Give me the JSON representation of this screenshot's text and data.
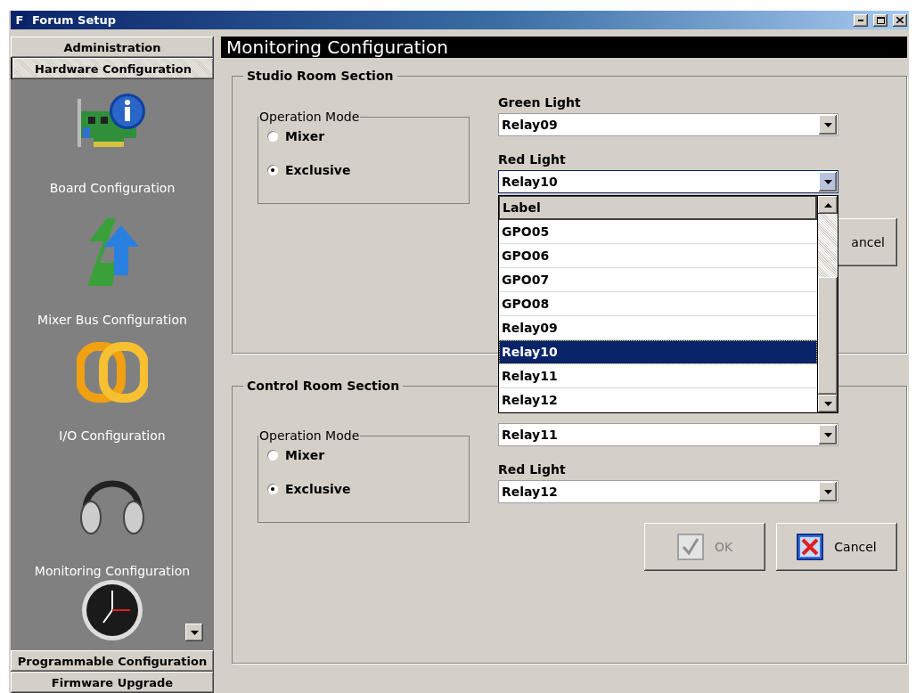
{
  "window": {
    "title": "Forum Setup",
    "icon_letter": "F"
  },
  "sidebar": {
    "tabs_top": [
      {
        "label": "Administration",
        "selected": false
      },
      {
        "label": "Hardware Configuration",
        "selected": true
      }
    ],
    "items": [
      {
        "label": "Board Configuration"
      },
      {
        "label": "Mixer Bus Configuration"
      },
      {
        "label": "I/O Configuration"
      },
      {
        "label": "Monitoring Configuration"
      }
    ],
    "tabs_bottom": [
      {
        "label": "Programmable Configuration",
        "selected": false
      },
      {
        "label": "Firmware Upgrade",
        "selected": false
      }
    ]
  },
  "main": {
    "title": "Monitoring Configuration",
    "sections": [
      {
        "title": "Studio Room Section",
        "operation_mode": {
          "label": "Operation Mode",
          "options": [
            {
              "label": "Mixer",
              "selected": false
            },
            {
              "label": "Exclusive",
              "selected": true
            }
          ]
        },
        "fields": [
          {
            "label": "Green Light",
            "value": "Relay09"
          },
          {
            "label": "Red Light",
            "value": "Relay10",
            "open_list": {
              "header": "Label",
              "options": [
                {
                  "label": "GPO05",
                  "selected": false
                },
                {
                  "label": "GPO06",
                  "selected": false
                },
                {
                  "label": "GPO07",
                  "selected": false
                },
                {
                  "label": "GPO08",
                  "selected": false
                },
                {
                  "label": "Relay09",
                  "selected": false
                },
                {
                  "label": "Relay10",
                  "selected": true
                },
                {
                  "label": "Relay11",
                  "selected": false
                },
                {
                  "label": "Relay12",
                  "selected": false
                }
              ]
            }
          }
        ],
        "buttons": [
          {
            "kind": "cancel",
            "label": "ancel",
            "disabled": false
          }
        ]
      },
      {
        "title": "Control Room Section",
        "operation_mode": {
          "label": "Operation Mode",
          "options": [
            {
              "label": "Mixer",
              "selected": false
            },
            {
              "label": "Exclusive",
              "selected": true
            }
          ]
        },
        "fields": [
          {
            "value": "Relay11"
          },
          {
            "label": "Red Light",
            "value": "Relay12"
          }
        ],
        "buttons": [
          {
            "kind": "ok",
            "label": "OK",
            "disabled": true
          },
          {
            "kind": "cancel",
            "label": "Cancel",
            "disabled": false
          }
        ]
      }
    ]
  }
}
